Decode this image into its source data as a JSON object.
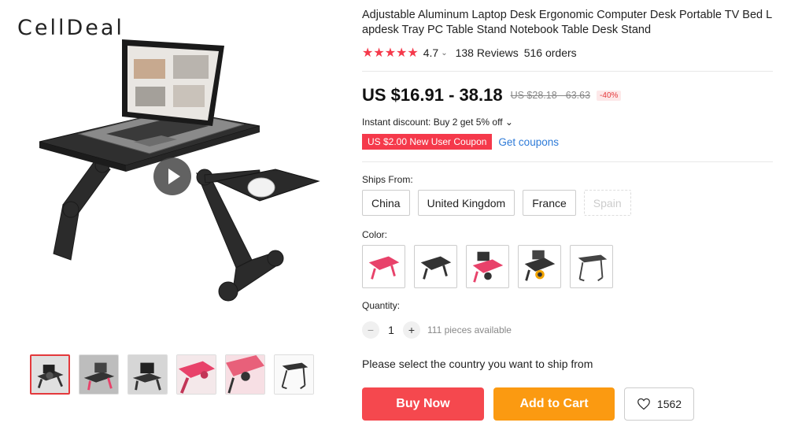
{
  "brand": {
    "logo_text": "CellDeal"
  },
  "gallery": {
    "main_image_alt": "adjustable-laptop-desk-main-photo",
    "thumbnails": [
      {
        "name": "thumb-1",
        "tint": "#cfcfcf"
      },
      {
        "name": "thumb-2",
        "tint": "#b9b9b9"
      },
      {
        "name": "thumb-3",
        "tint": "#d8d8d8"
      },
      {
        "name": "thumb-4",
        "tint": "#e8426a"
      },
      {
        "name": "thumb-5",
        "tint": "#e8607a"
      },
      {
        "name": "thumb-6",
        "tint": "#f2f2f2"
      }
    ]
  },
  "product": {
    "title": "Adjustable Aluminum Laptop Desk Ergonomic Computer Desk Portable TV Bed Lapdesk Tray PC Table Stand Notebook Table Desk Stand",
    "rating": {
      "stars": "★★★★★",
      "value": "4.7",
      "chevron": "⌄",
      "reviews": "138 Reviews",
      "orders": "516 orders"
    },
    "price": {
      "current": "US $16.91 - 38.18",
      "original": "US $28.18 - 63.63",
      "discount": "-40%"
    },
    "instant_discount": "Instant discount: Buy 2 get 5% off ⌄",
    "coupon": {
      "badge": "US $2.00 New User Coupon",
      "link": "Get coupons"
    },
    "ships_from": {
      "label": "Ships From:",
      "options": [
        {
          "label": "China",
          "enabled": true
        },
        {
          "label": "United Kingdom",
          "enabled": true
        },
        {
          "label": "France",
          "enabled": true
        },
        {
          "label": "Spain",
          "enabled": false
        }
      ]
    },
    "color": {
      "label": "Color:",
      "swatch_colors": [
        "#e8426a",
        "#333333",
        "#e8426a",
        "#333333",
        "#444444"
      ]
    },
    "quantity": {
      "label": "Quantity:",
      "minus": "−",
      "value": "1",
      "plus": "+",
      "available": "111 pieces available"
    },
    "ship_message": "Please select the country you want to ship from",
    "actions": {
      "buy_now": "Buy Now",
      "add_to_cart": "Add to Cart",
      "wishlist_count": "1562"
    }
  },
  "colors": {
    "accent_red": "#f5484e",
    "cart_orange": "#fb9a11",
    "link_blue": "#2e7bd8",
    "star_red": "#f5394b"
  }
}
